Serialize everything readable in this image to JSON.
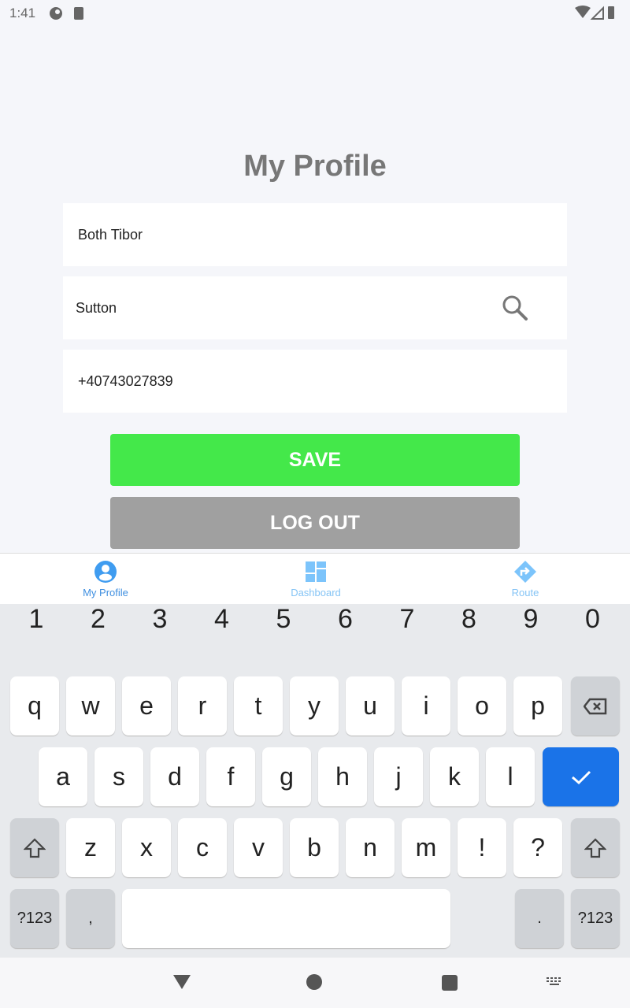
{
  "status_bar": {
    "time": "1:41"
  },
  "page": {
    "title": "My Profile"
  },
  "form": {
    "name_value": "Both Tibor",
    "city_value": "Sutton",
    "phone_value": "+40743027839"
  },
  "buttons": {
    "save": "SAVE",
    "logout": "LOG OUT"
  },
  "colors": {
    "save": "#44e84a",
    "logout": "#a0a0a0",
    "accent": "#3f9cf0",
    "enter": "#1a73e8"
  },
  "bottom_nav": {
    "items": [
      {
        "label": "My Profile",
        "icon": "account-circle-icon",
        "active": true
      },
      {
        "label": "Dashboard",
        "icon": "dashboard-icon",
        "active": false
      },
      {
        "label": "Route",
        "icon": "directions-icon",
        "active": false
      }
    ]
  },
  "keyboard": {
    "numbers": [
      "1",
      "2",
      "3",
      "4",
      "5",
      "6",
      "7",
      "8",
      "9",
      "0"
    ],
    "row1": [
      "q",
      "w",
      "e",
      "r",
      "t",
      "y",
      "u",
      "i",
      "o",
      "p"
    ],
    "row2": [
      "a",
      "s",
      "d",
      "f",
      "g",
      "h",
      "j",
      "k",
      "l"
    ],
    "row3": [
      "z",
      "x",
      "c",
      "v",
      "b",
      "n",
      "m",
      "!",
      "?"
    ],
    "symbols_label": "?123",
    "comma": ",",
    "period": "."
  }
}
